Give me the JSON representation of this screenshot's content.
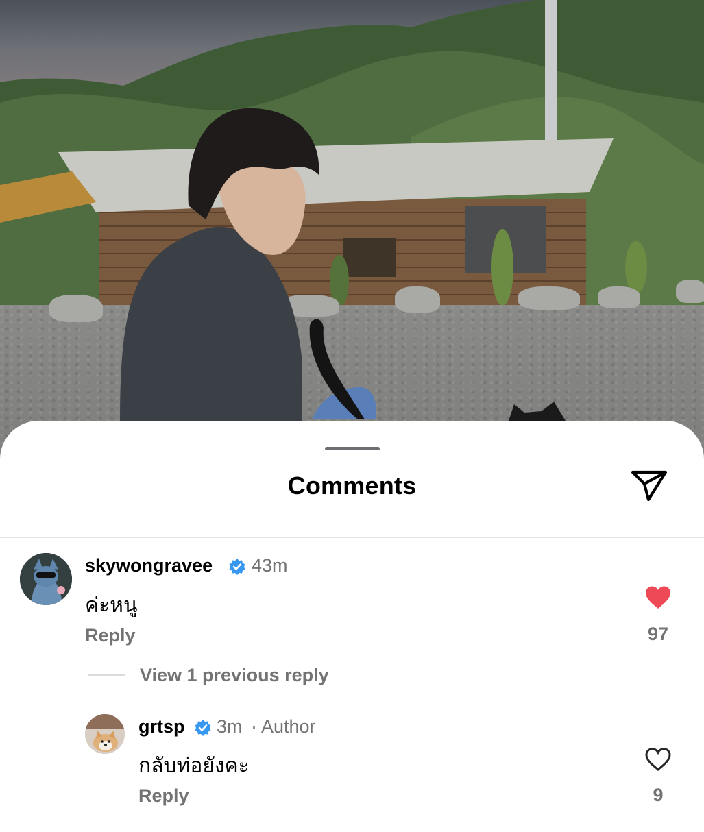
{
  "sheet": {
    "title": "Comments"
  },
  "comments": [
    {
      "username": "skywongravee",
      "verified": true,
      "time": "43m",
      "text": "ค่ะหนู",
      "reply_label": "Reply",
      "likes": "97",
      "liked": true
    }
  ],
  "view_replies_label": "View 1 previous reply",
  "replies": [
    {
      "username": "grtsp",
      "verified": true,
      "time": "3m",
      "author_tag": "· Author",
      "text": "กลับท่อยังคะ",
      "reply_label": "Reply",
      "likes": "9",
      "liked": false
    }
  ],
  "colors": {
    "liked_heart": "#ed4956",
    "verified_badge": "#3897f0",
    "secondary_text": "#737373"
  },
  "icons": [
    "share-icon",
    "verified-icon",
    "heart-filled-icon",
    "heart-outline-icon"
  ]
}
